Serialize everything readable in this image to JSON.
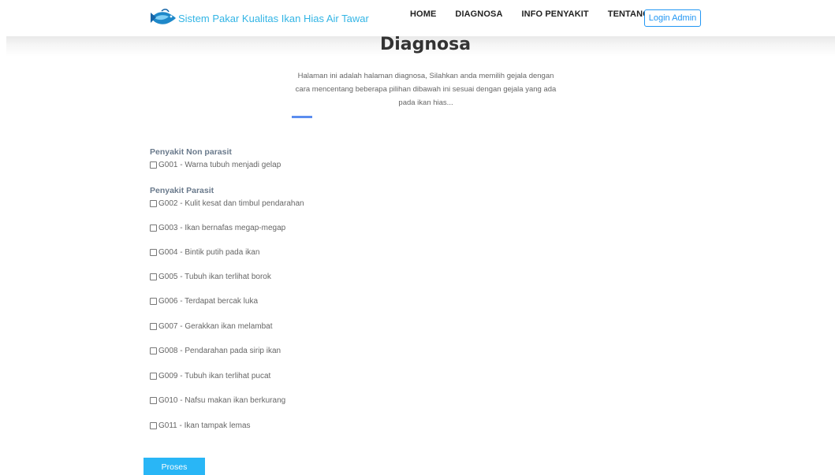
{
  "header": {
    "brand_title": "Sistem Pakar Kualitas Ikan Hias Air Tawar",
    "logo_icon": "fish-logo-icon",
    "nav": [
      {
        "label": "HOME"
      },
      {
        "label": "DIAGNOSA"
      },
      {
        "label": "INFO PENYAKIT"
      },
      {
        "label": "TENTANG"
      }
    ],
    "login_label": "Login Admin"
  },
  "main": {
    "title": "Diagnosa",
    "intro": "Halaman ini adalah halaman diagnosa, Silahkan anda memilih gejala dengan cara mencentang beberapa pilihan dibawah ini sesuai dengan gejala yang ada pada ikan hias...",
    "groups": [
      {
        "title": "Penyakit Non parasit",
        "symptoms": [
          {
            "label": "G001 - Warna tubuh menjadi gelap",
            "checked": false
          }
        ]
      },
      {
        "title": "Penyakit Parasit",
        "symptoms": [
          {
            "label": "G002 - Kulit kesat dan timbul pendarahan",
            "checked": false
          },
          {
            "label": "G003 - Ikan bernafas megap-megap",
            "checked": false
          },
          {
            "label": "G004 - Bintik putih pada ikan",
            "checked": false
          },
          {
            "label": "G005 - Tubuh ikan terlihat borok",
            "checked": false
          },
          {
            "label": "G006 - Terdapat bercak luka",
            "checked": false
          },
          {
            "label": "G007 - Gerakkan ikan melambat",
            "checked": false
          },
          {
            "label": "G008 - Pendarahan pada sirip ikan",
            "checked": false
          },
          {
            "label": "G009 - Tubuh ikan terlihat pucat",
            "checked": false
          },
          {
            "label": "G010 - Nafsu makan ikan berkurang",
            "checked": false
          },
          {
            "label": "G011 - Ikan tampak lemas",
            "checked": false
          }
        ]
      }
    ],
    "submit_label": "Proses"
  },
  "colors": {
    "brand": "#33b5e5",
    "accent": "#2196f3",
    "button": "#29b6f6",
    "divider": "#5b8def"
  }
}
